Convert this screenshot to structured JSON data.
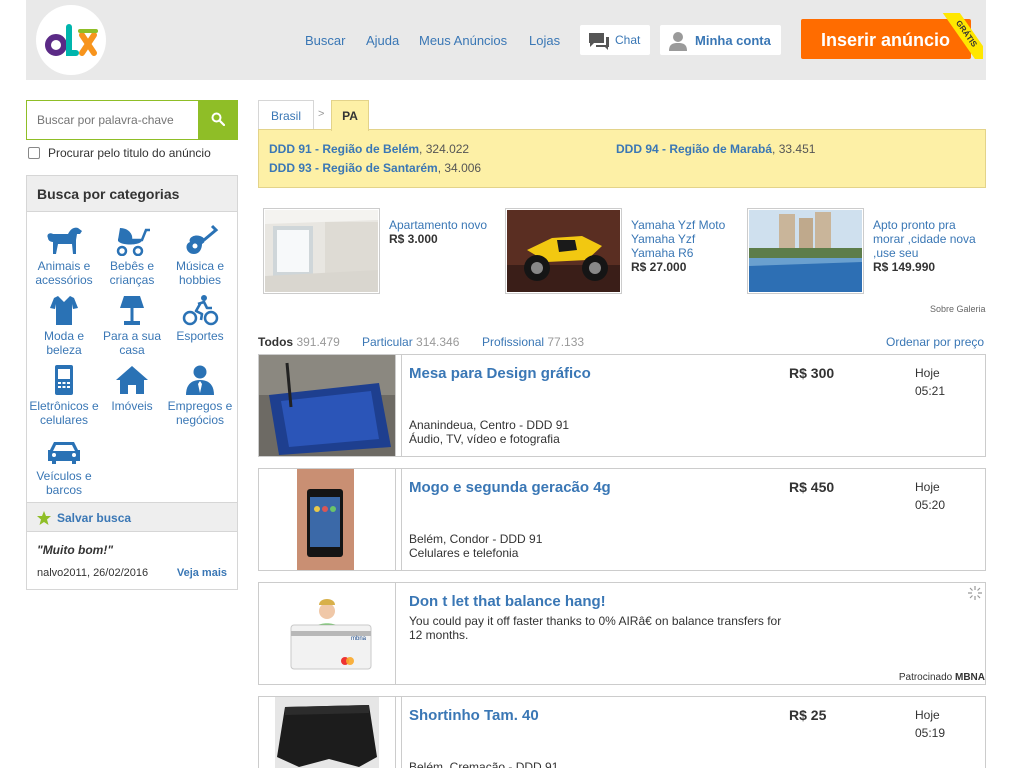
{
  "header": {
    "logo_text": "OLX",
    "nav": [
      "Buscar",
      "Ajuda",
      "Meus Anúncios",
      "Lojas"
    ],
    "chat_label": "Chat",
    "account_label": "Minha conta",
    "post_label": "Inserir anúncio",
    "post_badge": "GRÁTIS"
  },
  "search": {
    "placeholder": "Buscar por palavra-chave",
    "title_only_label": "Procurar pelo titulo do anúncio"
  },
  "categories": {
    "header": "Busca por categorias",
    "items": [
      {
        "label": "Animais e acessórios",
        "icon": "dog-icon"
      },
      {
        "label": "Bebês e crianças",
        "icon": "stroller-icon"
      },
      {
        "label": "Música e hobbies",
        "icon": "guitar-icon"
      },
      {
        "label": "Moda e beleza",
        "icon": "shirt-icon"
      },
      {
        "label": "Para a sua casa",
        "icon": "lamp-icon"
      },
      {
        "label": "Esportes",
        "icon": "cyclist-icon"
      },
      {
        "label": "Eletrônicos e celulares",
        "icon": "phone-icon"
      },
      {
        "label": "Imóveis",
        "icon": "house-icon"
      },
      {
        "label": "Empregos e negócios",
        "icon": "person-icon"
      },
      {
        "label": "Veículos e barcos",
        "icon": "car-icon"
      }
    ],
    "save_search": "Salvar busca",
    "review_quote": "\"Muito bom!\"",
    "review_meta": "nalvo2011, 26/02/2016",
    "review_more": "Veja mais"
  },
  "breadcrumb": {
    "country": "Brasil",
    "separator": ">",
    "state": "PA"
  },
  "regions": [
    {
      "name": "DDD 91 - Região de Belém",
      "count": ", 324.022"
    },
    {
      "name": "DDD 94 - Região de Marabá",
      "count": ", 33.451"
    },
    {
      "name": "DDD 93 - Região de Santarém",
      "count": ", 34.006"
    }
  ],
  "gallery": {
    "items": [
      {
        "title": "Apartamento novo",
        "price": "R$ 3.000"
      },
      {
        "title": "Yamaha Yzf Moto Yamaha Yzf Yamaha R6",
        "price": "R$ 27.000"
      },
      {
        "title": "Apto pronto pra morar ,cidade nova ,use seu",
        "price": "R$ 149.990"
      }
    ],
    "about": "Sobre Galeria"
  },
  "filters": {
    "all_label": "Todos",
    "all_count": "391.479",
    "private_label": "Particular",
    "private_count": "314.346",
    "pro_label": "Profissional",
    "pro_count": "77.133",
    "sort_label": "Ordenar por preço"
  },
  "listings": [
    {
      "title": "Mesa para Design gráfico",
      "price": "R$ 300",
      "day": "Hoje",
      "time": "05:21",
      "location": "Ananindeua, Centro - DDD 91",
      "category": "Áudio, TV, vídeo e fotografia"
    },
    {
      "title": "Mogo e segunda geracão 4g",
      "price": "R$ 450",
      "day": "Hoje",
      "time": "05:20",
      "location": "Belém, Condor - DDD 91",
      "category": "Celulares e telefonia"
    },
    {
      "title": "Shortinho Tam. 40",
      "price": "R$ 25",
      "day": "Hoje",
      "time": "05:19",
      "location": "Belém, Cremação - DDD 91",
      "category": ""
    }
  ],
  "ad": {
    "title": "Don t let that balance hang!",
    "body": "You could pay it off faster thanks to 0% AIRâ€  on balance transfers for 12 months.",
    "sponsor_prefix": "Patrocinado ",
    "sponsor_name": "MBNA"
  },
  "colors": {
    "link": "#3a77b5",
    "accent_orange": "#ff6c00",
    "accent_green": "#8fbe27",
    "highlight_yellow": "#fdf0a6"
  }
}
